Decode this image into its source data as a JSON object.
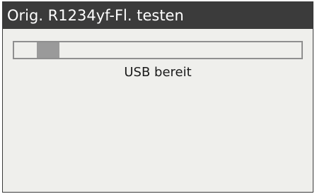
{
  "header": {
    "title": "Orig. R1234yf-Fl. testen"
  },
  "progress": {
    "indicator_start": 0.08,
    "indicator_end": 0.16
  },
  "status": {
    "text": "USB bereit"
  },
  "colors": {
    "title_bar_bg": "#3b3b3b",
    "title_text": "#ffffff",
    "screen_bg": "#efefec",
    "progress_border": "#8f8f8f",
    "progress_fill": "#9a9a9a"
  }
}
